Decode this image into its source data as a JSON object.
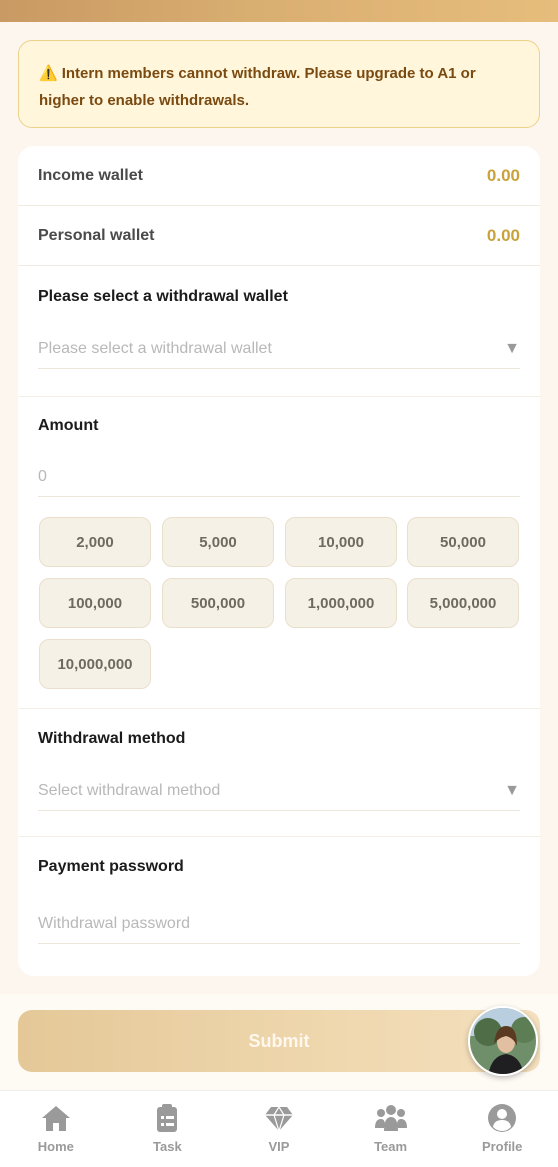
{
  "notice": {
    "icon": "warning-icon",
    "text": "Intern members cannot withdraw. Please upgrade to A1 or higher to enable withdrawals."
  },
  "wallets": [
    {
      "label": "Income wallet",
      "value": "0.00"
    },
    {
      "label": "Personal wallet",
      "value": "0.00"
    }
  ],
  "withdrawal_wallet": {
    "title": "Please select a withdrawal wallet",
    "placeholder": "Please select a withdrawal wallet"
  },
  "amount": {
    "title": "Amount",
    "placeholder": "0",
    "presets": [
      "2,000",
      "5,000",
      "10,000",
      "50,000",
      "100,000",
      "500,000",
      "1,000,000",
      "5,000,000",
      "10,000,000"
    ]
  },
  "withdrawal_method": {
    "title": "Withdrawal method",
    "placeholder": "Select withdrawal method"
  },
  "payment_password": {
    "title": "Payment password",
    "placeholder": "Withdrawal password"
  },
  "submit_label": "Submit",
  "tabs": [
    {
      "label": "Home",
      "icon": "home-icon"
    },
    {
      "label": "Task",
      "icon": "clipboard-icon"
    },
    {
      "label": "VIP",
      "icon": "diamond-icon"
    },
    {
      "label": "Team",
      "icon": "team-icon"
    },
    {
      "label": "Profile",
      "icon": "profile-icon"
    }
  ],
  "colors": {
    "accent": "#c9a23a",
    "submit_gradient_start": "#e4c898",
    "warning_background": "#fff6dc",
    "warning_text": "#7a4a10"
  }
}
